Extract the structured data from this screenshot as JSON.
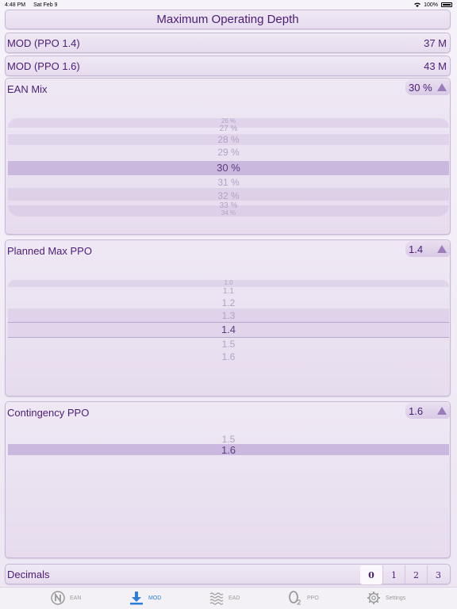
{
  "status_bar": {
    "time": "4:48 PM",
    "date": "Sat Feb 9",
    "battery": "100%"
  },
  "title": "Maximum Operating Depth",
  "mod_rows": [
    {
      "label": "MOD (PPO 1.4)",
      "value": "37 M"
    },
    {
      "label": "MOD (PPO 1.6)",
      "value": "43 M"
    }
  ],
  "ean_mix": {
    "label": "EAN Mix",
    "value": "30 %",
    "options": [
      "26 %",
      "27 %",
      "28 %",
      "29 %",
      "30 %",
      "31 %",
      "32 %",
      "33 %",
      "34 %"
    ],
    "selected": "30 %"
  },
  "planned_max_ppo": {
    "label": "Planned Max PPO",
    "value": "1.4",
    "options": [
      "1.0",
      "1.1",
      "1.2",
      "1.3",
      "1.4",
      "1.5",
      "1.6"
    ],
    "selected": "1.4"
  },
  "contingency_ppo": {
    "label": "Contingency PPO",
    "value": "1.6",
    "options": [
      "1.5",
      "1.6"
    ],
    "selected": "1.6"
  },
  "decimals": {
    "label": "Decimals",
    "options": [
      "0",
      "1",
      "2",
      "3"
    ],
    "selected": "0"
  },
  "tabs": [
    {
      "label": "EAN",
      "icon": "n-circle-icon",
      "active": false
    },
    {
      "label": "MOD",
      "icon": "download-arrow-icon",
      "active": true
    },
    {
      "label": "EAD",
      "icon": "waves-icon",
      "active": false
    },
    {
      "label": "PPO",
      "icon": "o2-icon",
      "active": false
    },
    {
      "label": "Settings",
      "icon": "gear-icon",
      "active": false
    }
  ],
  "colors": {
    "accent": "#4b1d75",
    "tab_active": "#2b7fd8",
    "selection": "#cbb8df"
  }
}
